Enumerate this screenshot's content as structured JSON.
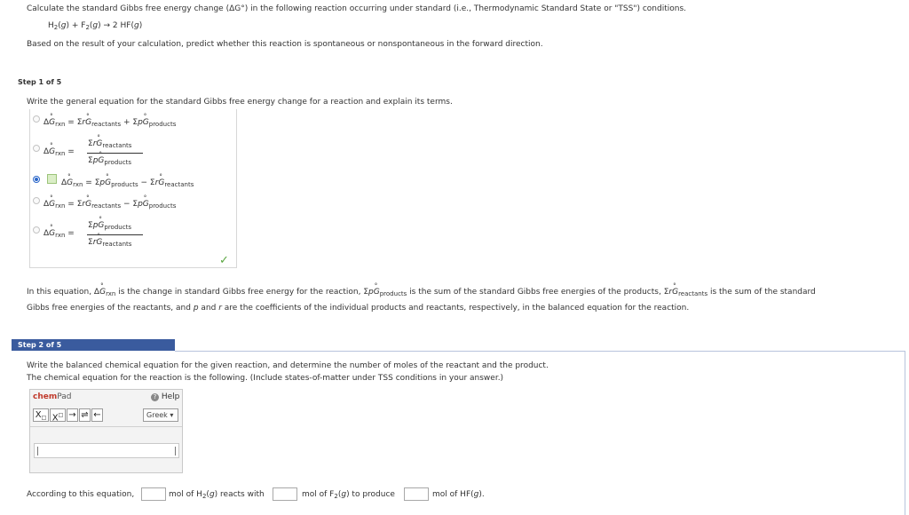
{
  "question": {
    "prompt": "Calculate the standard Gibbs free energy change (ΔG°) in the following reaction occurring under standard (i.e., Thermodynamic Standard State or \"TSS\") conditions.",
    "reaction": "H2(g) + F2(g) → 2 HF(g)",
    "follow_up": "Based on the result of your calculation, predict whether this reaction is spontaneous or nonspontaneous in the forward direction."
  },
  "step1": {
    "label": "Step 1 of 5",
    "instruction": "Write the general equation for the standard Gibbs free energy change for a reaction and explain its terms.",
    "options": [
      {
        "lhs": "ΔG°rxn",
        "rhs": "= ΣrG°reactants + ΣpG°products",
        "selected": false
      },
      {
        "lhs": "ΔG°rxn",
        "num": "ΣrG°reactants",
        "den": "ΣpG°products",
        "selected": false
      },
      {
        "lhs": "ΔG°rxn",
        "rhs": "= ΣpG°products − ΣrG°reactants",
        "selected": true
      },
      {
        "lhs": "ΔG°rxn",
        "rhs": "= ΣrG°reactants − ΣpG°products",
        "selected": false
      },
      {
        "lhs": "ΔG°rxn",
        "num": "ΣpG°products",
        "den": "ΣrG°reactants",
        "selected": false
      }
    ],
    "explanation_1": "In this equation, ΔG°rxn is the change in standard Gibbs free energy for the reaction, ΣpG°products is the sum of the standard Gibbs free energies of the products, ΣrG°reactants is the sum of the standard",
    "explanation_2": "Gibbs free energies of the reactants, and p and r are the coefficients of the individual products and reactants, respectively, in the balanced equation for the reaction."
  },
  "step2": {
    "label": "Step 2 of 5",
    "instruction": "Write the balanced chemical equation for the given reaction, and determine the number of moles of the reactant and the product.",
    "equation_line": "The chemical equation for the reaction is the following. (Include states-of-matter under TSS conditions in your answer.)",
    "chempad": {
      "title_a": "chem",
      "title_b": "Pad",
      "help": "Help",
      "greek": "Greek",
      "buttons": [
        "Xₐ",
        "Xᵃ",
        "→",
        "⇌",
        "←"
      ]
    },
    "answer_line": {
      "prefix": "According to this equation,",
      "part1": "mol of H2(g) reacts with",
      "part2": "mol of F2(g) to produce",
      "part3": "mol of HF(g)."
    }
  }
}
